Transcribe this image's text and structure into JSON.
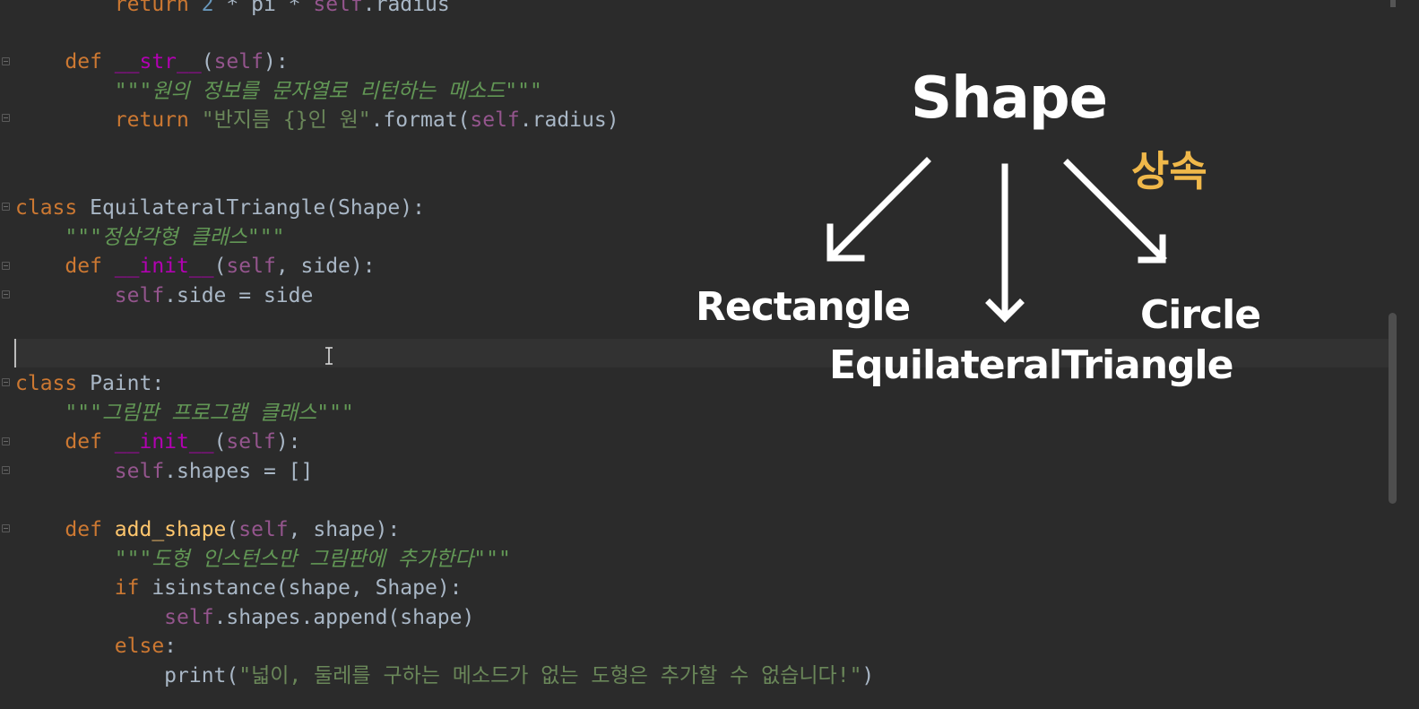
{
  "editor": {
    "lines": [
      {
        "segments": [
          {
            "t": "        return ",
            "c": "kw"
          },
          {
            "t": "2",
            "c": "num"
          },
          {
            "t": " * pi * ",
            "c": ""
          },
          {
            "t": "self",
            "c": "self"
          },
          {
            "t": ".radius",
            "c": ""
          }
        ]
      },
      {
        "segments": [
          {
            "t": "    def ",
            "c": "kw"
          },
          {
            "t": "__str__",
            "c": "magic"
          },
          {
            "t": "(",
            "c": ""
          },
          {
            "t": "self",
            "c": "self"
          },
          {
            "t": "):",
            "c": ""
          }
        ]
      },
      {
        "segments": [
          {
            "t": "        \"\"\"원의 정보를 문자열로 리턴하는 메소드\"\"\"",
            "c": "doc"
          }
        ]
      },
      {
        "segments": [
          {
            "t": "        return ",
            "c": "kw"
          },
          {
            "t": "\"반지름 {}인 원\"",
            "c": "str"
          },
          {
            "t": ".format(",
            "c": ""
          },
          {
            "t": "self",
            "c": "self"
          },
          {
            "t": ".radius)",
            "c": ""
          }
        ]
      },
      {
        "segments": [
          {
            "t": "class ",
            "c": "kw"
          },
          {
            "t": "EquilateralTriangle(Shape):",
            "c": ""
          }
        ]
      },
      {
        "segments": [
          {
            "t": "    \"\"\"정삼각형 클래스\"\"\"",
            "c": "doc"
          }
        ]
      },
      {
        "segments": [
          {
            "t": "    def ",
            "c": "kw"
          },
          {
            "t": "__init__",
            "c": "magic"
          },
          {
            "t": "(",
            "c": ""
          },
          {
            "t": "self",
            "c": "self"
          },
          {
            "t": ", side):",
            "c": ""
          }
        ]
      },
      {
        "segments": [
          {
            "t": "        ",
            "c": ""
          },
          {
            "t": "self",
            "c": "self"
          },
          {
            "t": ".side = side",
            "c": ""
          }
        ]
      },
      {
        "segments": [
          {
            "t": "class ",
            "c": "kw"
          },
          {
            "t": "Paint:",
            "c": ""
          }
        ]
      },
      {
        "segments": [
          {
            "t": "    \"\"\"그림판 프로그램 클래스\"\"\"",
            "c": "doc"
          }
        ]
      },
      {
        "segments": [
          {
            "t": "    def ",
            "c": "kw"
          },
          {
            "t": "__init__",
            "c": "magic"
          },
          {
            "t": "(",
            "c": ""
          },
          {
            "t": "self",
            "c": "self"
          },
          {
            "t": "):",
            "c": ""
          }
        ]
      },
      {
        "segments": [
          {
            "t": "        ",
            "c": ""
          },
          {
            "t": "self",
            "c": "self"
          },
          {
            "t": ".shapes = []",
            "c": ""
          }
        ]
      },
      {
        "segments": [
          {
            "t": "    def ",
            "c": "kw"
          },
          {
            "t": "add_shape",
            "c": "fn"
          },
          {
            "t": "(",
            "c": ""
          },
          {
            "t": "self",
            "c": "self"
          },
          {
            "t": ", shape):",
            "c": ""
          }
        ]
      },
      {
        "segments": [
          {
            "t": "        \"\"\"도형 인스턴스만 그림판에 추가한다\"\"\"",
            "c": "doc"
          }
        ]
      },
      {
        "segments": [
          {
            "t": "        if ",
            "c": "kw"
          },
          {
            "t": "isinstance(shape, Shape):",
            "c": ""
          }
        ]
      },
      {
        "segments": [
          {
            "t": "            ",
            "c": ""
          },
          {
            "t": "self",
            "c": "self"
          },
          {
            "t": ".shapes.append(shape)",
            "c": ""
          }
        ]
      },
      {
        "segments": [
          {
            "t": "        else",
            "c": "kw"
          },
          {
            "t": ":",
            "c": ""
          }
        ]
      },
      {
        "segments": [
          {
            "t": "            print(",
            "c": ""
          },
          {
            "t": "\"넓이, 둘레를 구하는 메소드가 없는 도형은 추가할 수 없습니다!\"",
            "c": "str"
          },
          {
            "t": ")",
            "c": ""
          }
        ]
      }
    ]
  },
  "diagram": {
    "root": "Shape",
    "relation_label": "상속",
    "children": [
      "Rectangle",
      "EquilateralTriangle",
      "Circle"
    ],
    "text_color": "#ffffff",
    "relation_color": "#f0b84a"
  },
  "colors": {
    "background": "#2b2b2b",
    "keyword": "#cc7832",
    "docstring": "#629755",
    "string": "#6a8759",
    "magic": "#b200b2",
    "self": "#94558d"
  }
}
